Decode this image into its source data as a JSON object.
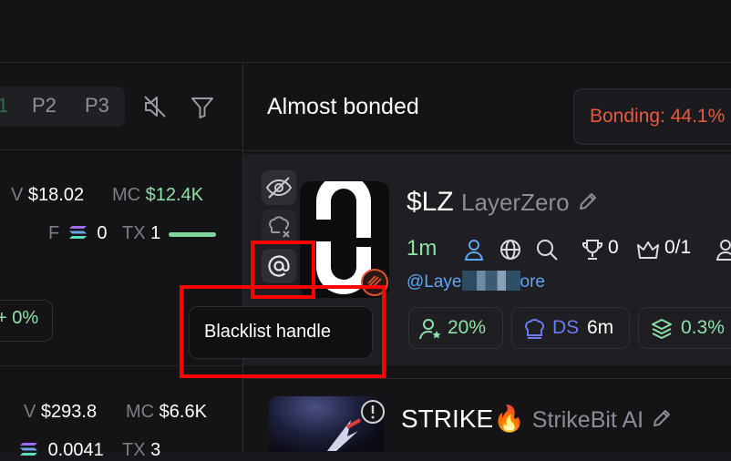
{
  "pager": {
    "p1": "1",
    "p2": "P2",
    "p3": "P3"
  },
  "left_rows": [
    {
      "v_label": "V",
      "v_value": "$18.02",
      "mc_label": "MC",
      "mc_value": "$12.4K",
      "f_label": "F",
      "f_value": "0",
      "tx_label": "TX",
      "tx_value": "1"
    },
    {
      "pct": "+ 0%"
    },
    {
      "v_label": "V",
      "v_value": "$293.8",
      "mc_label": "MC",
      "mc_value": "$6.6K",
      "f_value": "0.0041",
      "tx_label": "TX",
      "tx_value": "3"
    }
  ],
  "section": {
    "title": "Almost bonded"
  },
  "bonding": {
    "text": "Bonding: 44.1%"
  },
  "token1": {
    "ticker": "$LZ",
    "name": "LayerZero",
    "age": "1m",
    "holders_top": "0",
    "crown": "0/1",
    "handle_start": "@Laye",
    "handle_end": "ore",
    "chip1": "20%",
    "chip2_label": "DS",
    "chip2_value": "6m",
    "chip3": "0.3%"
  },
  "tooltip": {
    "text": "Blacklist handle"
  },
  "token2": {
    "ticker": "STRIKE",
    "emoji": "🔥",
    "name": "StrikeBit AI"
  },
  "colors": {
    "accent_green": "#8fe0a6",
    "bonding_orange": "#ea5a3a",
    "link_blue": "#5ea7f2",
    "highlight_red": "#ff0000"
  }
}
